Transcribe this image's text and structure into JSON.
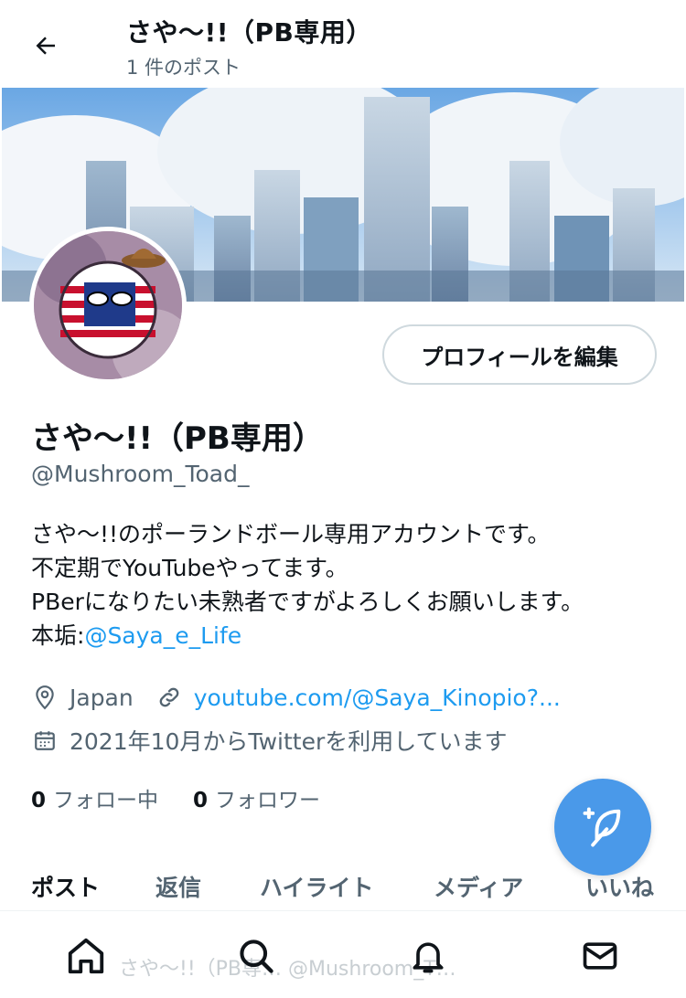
{
  "header": {
    "title": "さや〜!!（PB専用）",
    "subtitle": "1 件のポスト"
  },
  "profile": {
    "edit_button": "プロフィールを編集",
    "display_name": "さや〜!!（PB専用）",
    "handle": "@Mushroom_Toad_",
    "bio": {
      "line1": "さや〜!!のポーランドボール専用アカウントです。",
      "line2": "不定期でYouTubeやってます。",
      "line3": "PBerになりたい未熟者ですがよろしくお願いします。",
      "line4_prefix": "本垢:",
      "line4_link": "@Saya_e_Life"
    },
    "location": "Japan",
    "website": "youtube.com/@Saya_Kinopio?...",
    "joined": "2021年10月からTwitterを利用しています",
    "following_count": "0",
    "following_label": "フォロー中",
    "followers_count": "0",
    "followers_label": "フォロワー"
  },
  "tabs": [
    {
      "label": "ポスト",
      "active": true
    },
    {
      "label": "返信",
      "active": false
    },
    {
      "label": "ハイライト",
      "active": false
    },
    {
      "label": "メディア",
      "active": false
    },
    {
      "label": "いいね",
      "active": false
    }
  ],
  "bottom_nav": {
    "peek_text": "さや〜!!（PB専… @Mushroom_T… "
  },
  "colors": {
    "accent": "#1d9bf0",
    "fab": "#4a99e9",
    "muted": "#536471"
  }
}
